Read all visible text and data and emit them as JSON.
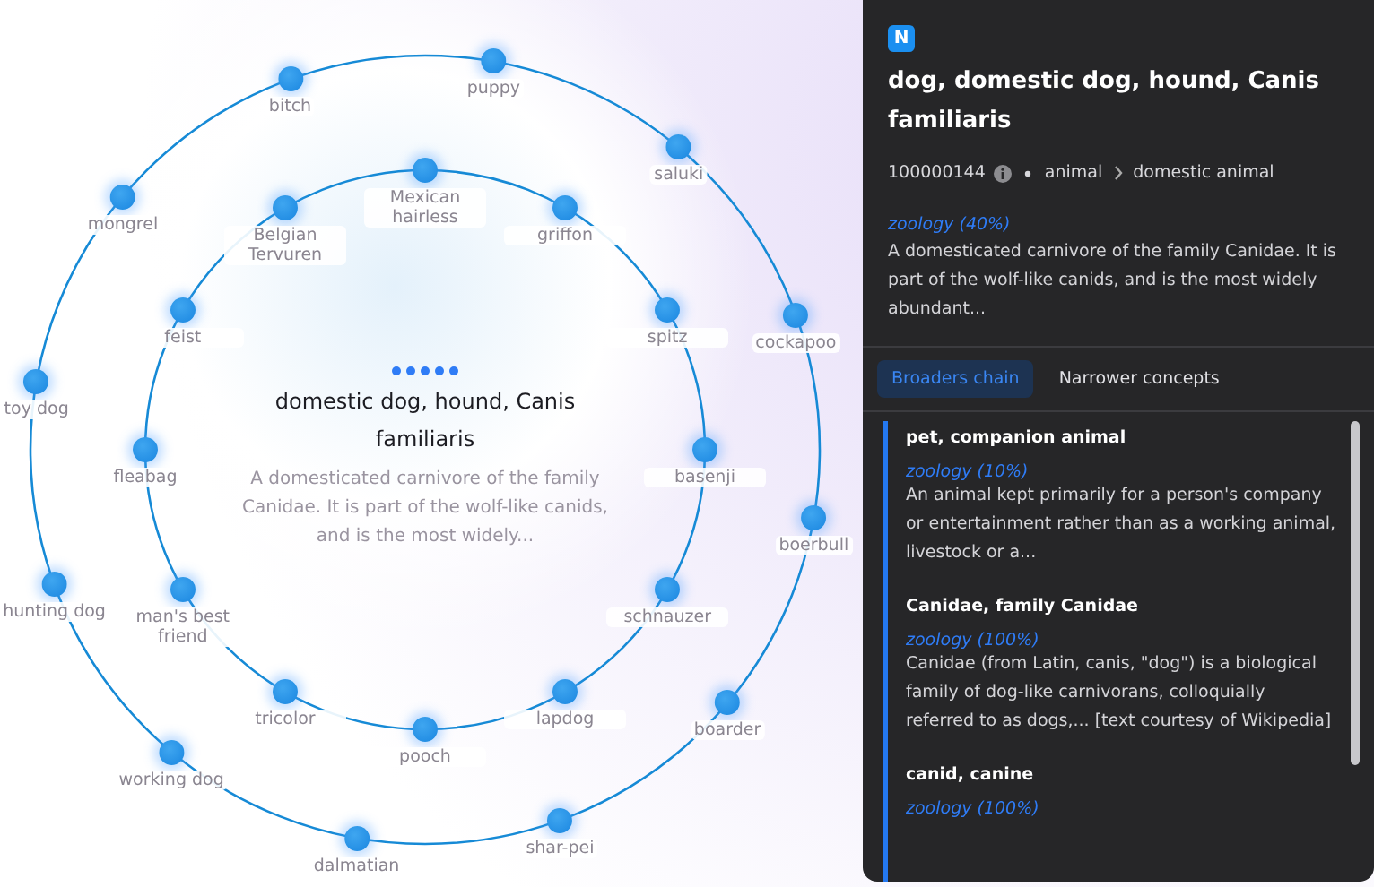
{
  "graph": {
    "center": {
      "title": "domestic dog, hound, Canis familiaris",
      "description": "A domesticated carnivore of the family Canidae. It is part of the wolf-like canids, and is the most widely..."
    },
    "inner_ring": [
      "Mexican hairless",
      "Belgian Tervuren",
      "griffon",
      "feist",
      "spitz",
      "fleabag",
      "basenji",
      "man's best friend",
      "schnauzer",
      "tricolor",
      "lapdog",
      "pooch"
    ],
    "outer_ring": [
      "puppy",
      "bitch",
      "saluki",
      "mongrel",
      "cockapoo",
      "toy dog",
      "boerbull",
      "hunting dog",
      "boarder",
      "working dog",
      "shar-pei",
      "dalmatian"
    ]
  },
  "panel": {
    "badge": "N",
    "title": "dog, domestic dog, hound, Canis familiaris",
    "id": "100000144",
    "breadcrumb": [
      "animal",
      "domestic animal"
    ],
    "domain": "zoology (40%)",
    "description": "A domesticated carnivore of the family Canidae. It is part of the wolf-like canids, and is the most widely abundant...",
    "tabs": [
      {
        "label": "Broaders chain",
        "selected": true
      },
      {
        "label": "Narrower concepts",
        "selected": false
      }
    ],
    "chain": [
      {
        "name": "pet, companion animal",
        "domain": "zoology (10%)",
        "description": "An animal kept primarily for a person's company or entertainment rather than as a working animal, livestock or a..."
      },
      {
        "name": "Canidae, family Canidae",
        "domain": "zoology (100%)",
        "description": "Canidae (from Latin, canis, \"dog\") is a biological family of dog-like carnivorans, colloquially referred to as dogs,... [text courtesy of Wikipedia]"
      },
      {
        "name": "canid, canine",
        "domain": "zoology (100%)"
      }
    ]
  }
}
